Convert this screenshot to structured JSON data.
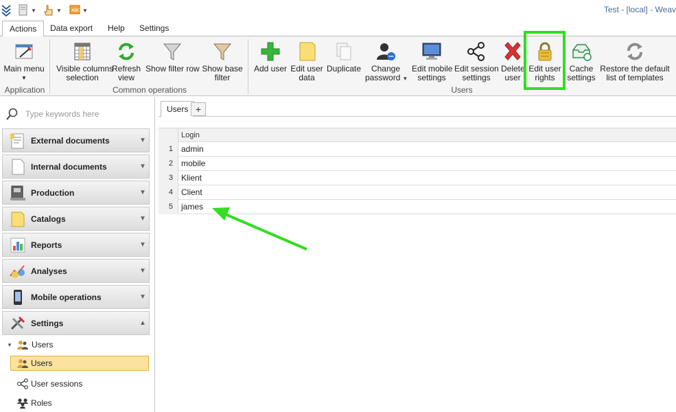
{
  "window": {
    "title": "Test - [local] - Weav"
  },
  "ribbon_tabs": [
    "Actions",
    "Data export",
    "Help",
    "Settings"
  ],
  "ribbon": {
    "buttons": {
      "main_menu": "Main menu",
      "visible_columns_1": "Visible columns",
      "visible_columns_2": "selection",
      "refresh_1": "Refresh",
      "refresh_2": "view",
      "show_filter_row": "Show filter row",
      "show_base_filter_1": "Show base",
      "show_base_filter_2": "filter",
      "add_user": "Add user",
      "edit_user_data_1": "Edit user",
      "edit_user_data_2": "data",
      "duplicate": "Duplicate",
      "change_password_1": "Change",
      "change_password_2": "password",
      "edit_mobile_1": "Edit mobile",
      "edit_mobile_2": "settings",
      "edit_session_1": "Edit session",
      "edit_session_2": "settings",
      "delete_user_1": "Delete",
      "delete_user_2": "user",
      "edit_rights_1": "Edit user",
      "edit_rights_2": "rights",
      "cache_1": "Cache",
      "cache_2": "settings",
      "restore_1": "Restore the default",
      "restore_2": "list of templates"
    },
    "groups": {
      "application": "Application",
      "common": "Common operations",
      "users": "Users"
    }
  },
  "nav": {
    "search_placeholder": "Type keywords here",
    "groups": [
      "External documents",
      "Internal documents",
      "Production",
      "Catalogs",
      "Reports",
      "Analyses",
      "Mobile operations",
      "Settings"
    ],
    "tree": {
      "users_parent": "Users",
      "users_child": "Users",
      "user_sessions": "User sessions",
      "roles": "Roles"
    }
  },
  "content": {
    "tab_label": "Users",
    "add_tab": "+",
    "column_header": "Login",
    "rows": [
      {
        "num": "1",
        "login": "admin"
      },
      {
        "num": "2",
        "login": "mobile"
      },
      {
        "num": "3",
        "login": "Klient"
      },
      {
        "num": "4",
        "login": "Client"
      },
      {
        "num": "5",
        "login": "james"
      }
    ]
  },
  "colors": {
    "highlight_box": "#33dd22",
    "arrow": "#33dd22",
    "selection": "#fbe29e",
    "title_text": "#4a6b95"
  }
}
